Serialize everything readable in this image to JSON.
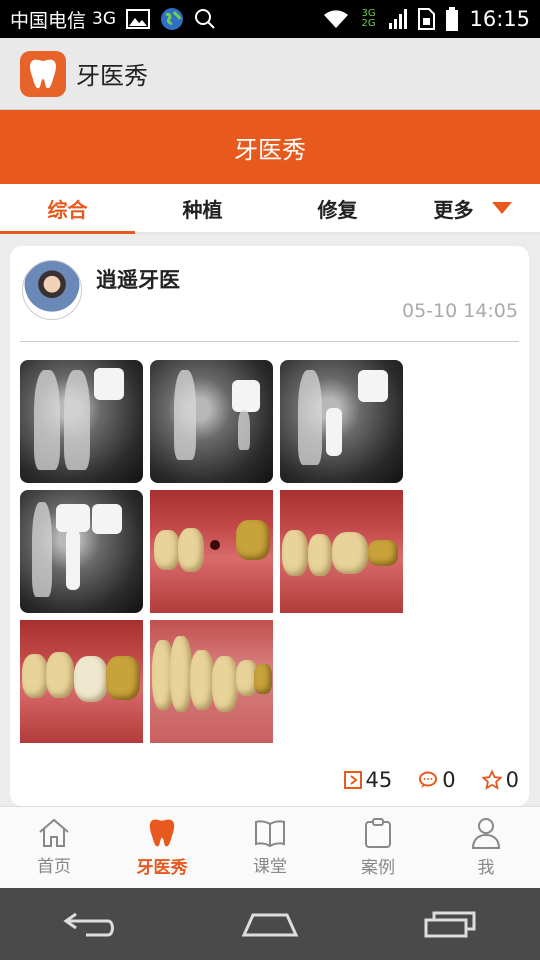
{
  "status_bar": {
    "carrier": "中国电信",
    "network": "3G",
    "signal_label": "3G 2G",
    "time": "16:15"
  },
  "app": {
    "title": "牙医秀",
    "logo_icon": "tooth-logo-icon",
    "brand_color": "#e8591e"
  },
  "header": {
    "title": "牙医秀"
  },
  "tabs": [
    {
      "label": "综合",
      "active": true
    },
    {
      "label": "种植",
      "active": false
    },
    {
      "label": "修复",
      "active": false
    },
    {
      "label": "更多",
      "active": false
    }
  ],
  "post": {
    "author": "逍遥牙医",
    "timestamp": "05-10 14:05",
    "image_count": 8,
    "stats": {
      "views": "45",
      "comments": "0",
      "favorites": "0"
    }
  },
  "bottom_nav": [
    {
      "label": "首页",
      "icon": "home-icon",
      "active": false
    },
    {
      "label": "牙医秀",
      "icon": "tooth-icon",
      "active": true
    },
    {
      "label": "课堂",
      "icon": "book-icon",
      "active": false
    },
    {
      "label": "案例",
      "icon": "clipboard-icon",
      "active": false
    },
    {
      "label": "我",
      "icon": "person-icon",
      "active": false
    }
  ]
}
